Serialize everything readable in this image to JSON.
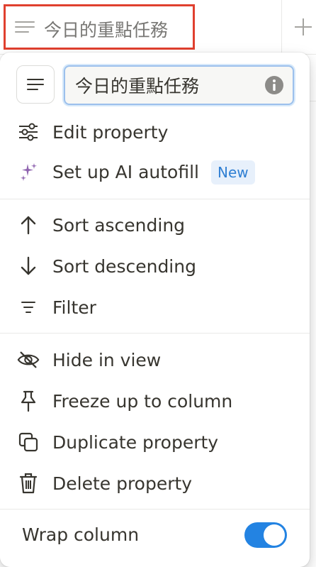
{
  "header": {
    "property_title": "今日的重點任務",
    "property_icon": "text-lines-icon",
    "add_column_icon": "plus-icon"
  },
  "menu": {
    "name_input_value": "今日的重點任務",
    "type_icon": "text-lines-icon",
    "groups": [
      [
        {
          "id": "edit-property",
          "label": "Edit property",
          "icon": "sliders-icon"
        },
        {
          "id": "ai-autofill",
          "label": "Set up AI autofill",
          "icon": "sparkles-icon",
          "badge": "New"
        }
      ],
      [
        {
          "id": "sort-ascending",
          "label": "Sort ascending",
          "icon": "arrow-up-icon"
        },
        {
          "id": "sort-descending",
          "label": "Sort descending",
          "icon": "arrow-down-icon"
        },
        {
          "id": "filter",
          "label": "Filter",
          "icon": "filter-icon"
        }
      ],
      [
        {
          "id": "hide-in-view",
          "label": "Hide in view",
          "icon": "eye-slash-icon"
        },
        {
          "id": "freeze-column",
          "label": "Freeze up to column",
          "icon": "pin-icon"
        },
        {
          "id": "duplicate-property",
          "label": "Duplicate property",
          "icon": "duplicate-icon"
        },
        {
          "id": "delete-property",
          "label": "Delete property",
          "icon": "trash-icon"
        }
      ]
    ],
    "wrap_column": {
      "label": "Wrap column",
      "enabled": true
    }
  },
  "colors": {
    "accent": "#2383e2",
    "highlight_border": "#e0402f",
    "badge_bg": "#e7f0fb",
    "badge_text": "#2f7fd3",
    "ai_icon": "#9065b0"
  }
}
